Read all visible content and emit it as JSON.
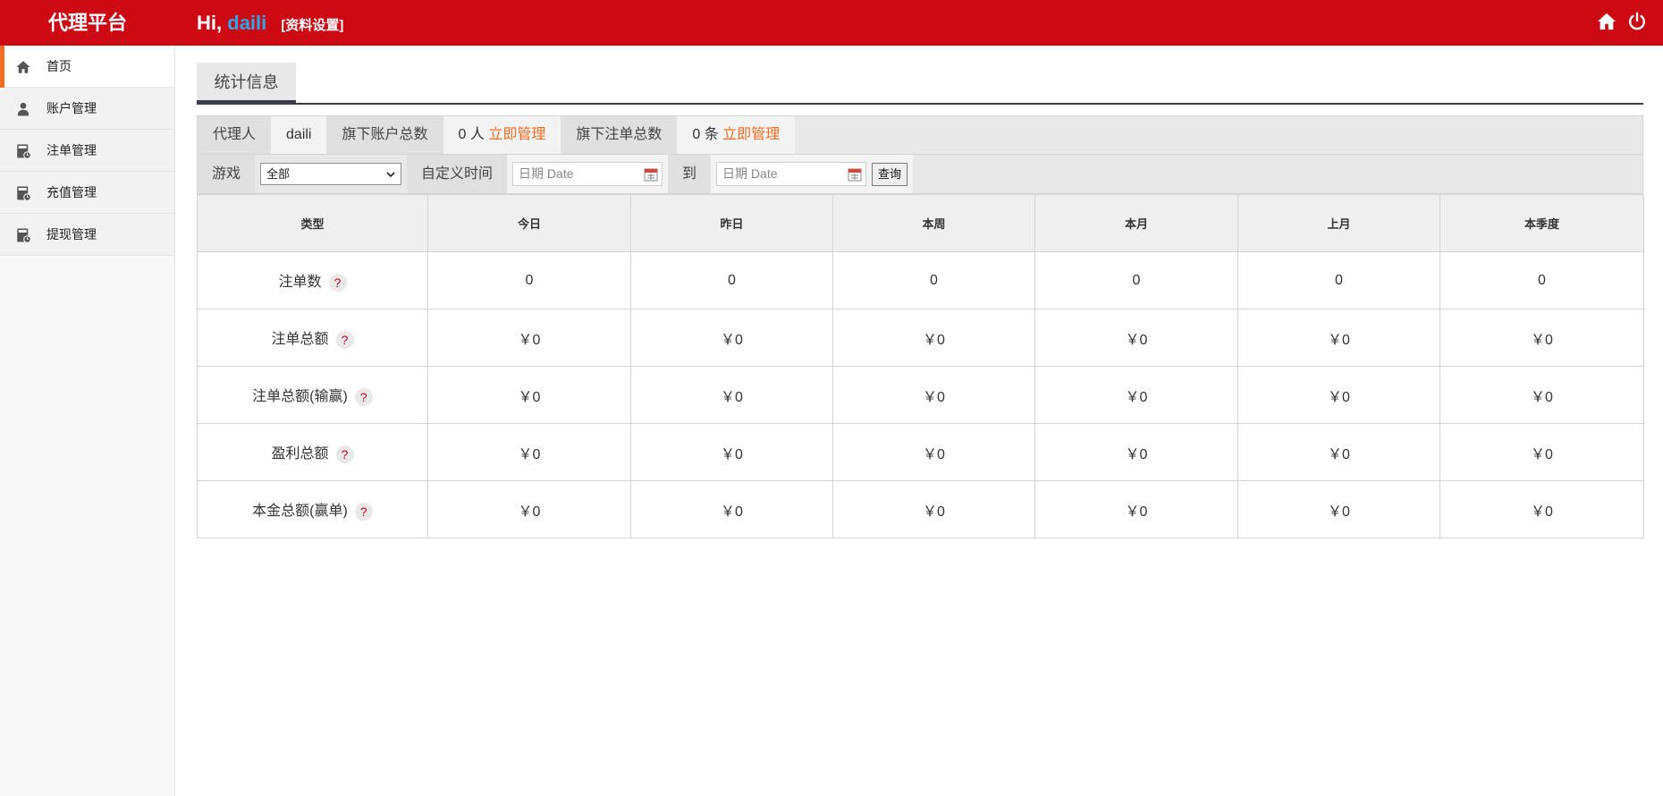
{
  "header": {
    "brand": "代理平台",
    "hi": "Hi,",
    "username": "daili",
    "settings_link": "[资料设置]",
    "icons": [
      "home-icon",
      "power-icon"
    ],
    "bg_color": "#cd0a14",
    "user_color": "#29a9ea"
  },
  "sidebar": {
    "items": [
      {
        "label": "首页",
        "icon": "home-icon",
        "active": true
      },
      {
        "label": "账户管理",
        "icon": "user-icon"
      },
      {
        "label": "注单管理",
        "icon": "calc-icon"
      },
      {
        "label": "充值管理",
        "icon": "calc-icon"
      },
      {
        "label": "提现管理",
        "icon": "calc-icon"
      }
    ]
  },
  "tabs": {
    "active": "统计信息"
  },
  "info": {
    "agent_label": "代理人",
    "agent_value": "daili",
    "accounts_label": "旗下账户总数",
    "accounts_value": "0 人",
    "accounts_link": "立即管理",
    "orders_label": "旗下注单总数",
    "orders_value": "0 条",
    "orders_link": "立即管理",
    "link_color": "#f36c21"
  },
  "filters": {
    "game_label": "游戏",
    "game_selected": "全部",
    "custom_time_label": "自定义时间",
    "date_placeholder": "日期 Date",
    "to_label": "到",
    "query_button": "查询"
  },
  "table": {
    "headers": [
      "类型",
      "今日",
      "昨日",
      "本周",
      "本月",
      "上月",
      "本季度"
    ],
    "rows": [
      {
        "label": "注单数",
        "values": [
          "0",
          "0",
          "0",
          "0",
          "0",
          "0"
        ]
      },
      {
        "label": "注单总额",
        "values": [
          "￥0",
          "￥0",
          "￥0",
          "￥0",
          "￥0",
          "￥0"
        ]
      },
      {
        "label": "注单总额(输赢)",
        "values": [
          "￥0",
          "￥0",
          "￥0",
          "￥0",
          "￥0",
          "￥0"
        ]
      },
      {
        "label": "盈利总额",
        "values": [
          "￥0",
          "￥0",
          "￥0",
          "￥0",
          "￥0",
          "￥0"
        ]
      },
      {
        "label": "本金总额(赢单)",
        "values": [
          "￥0",
          "￥0",
          "￥0",
          "￥0",
          "￥0",
          "￥0"
        ]
      }
    ],
    "help_glyph": "?"
  }
}
